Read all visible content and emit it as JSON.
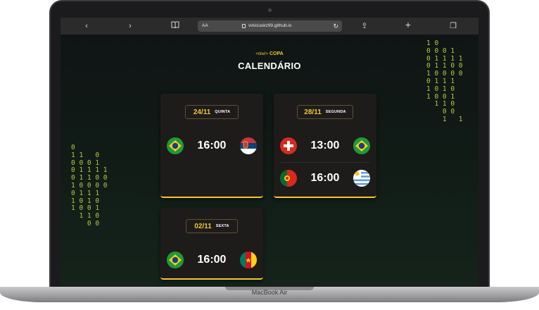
{
  "device": {
    "model_label": "MacBook Air"
  },
  "browser": {
    "aa_label": "AA",
    "url": "viniciuskz99.github.io",
    "back_glyph": "‹",
    "forward_glyph": "›",
    "reload_glyph": "↻",
    "share_glyph": "⇪",
    "new_tab_glyph": "+",
    "tabs_glyph": "❐"
  },
  "header": {
    "brand_tag": "<nlw/>",
    "brand_name": "COPA",
    "title": "CALENDÁRIO"
  },
  "binary_left": "0\n1 1   0\n0 0 0 1\n0 1 1 1 1\n0 1 1 0 0\n1 0 0 0 0\n0 1 1 1\n1 0 1 0\n1 0 0 1\n  1 1 0\n    0 0",
  "binary_right": "1 0\n0 0 0 1\n0 1 1 1 1\n0 1 1 0 0\n1 0 0 0 0\n0 1 1 1\n1 0 1 0\n1 0 0 1\n  1 1 0\n    0 0\n    1   1",
  "schedule": [
    {
      "date": "24/11",
      "weekday": "QUINTA",
      "matches": [
        {
          "time": "16:00",
          "home_flag": "brazil-flag-icon",
          "away_flag": "serbia-flag-icon"
        }
      ]
    },
    {
      "date": "28/11",
      "weekday": "SEGUNDA",
      "matches": [
        {
          "time": "13:00",
          "home_flag": "switzerland-flag-icon",
          "away_flag": "brazil-flag-icon"
        },
        {
          "time": "16:00",
          "home_flag": "portugal-flag-icon",
          "away_flag": "uruguay-flag-icon"
        }
      ]
    },
    {
      "date": "02/11",
      "weekday": "SEXTA",
      "matches": [
        {
          "time": "16:00",
          "home_flag": "brazil-flag-icon",
          "away_flag": "cameroon-flag-icon"
        }
      ]
    }
  ],
  "colors": {
    "accent": "#f3c928",
    "card": "#1e1c1a",
    "background": "#101a16"
  }
}
